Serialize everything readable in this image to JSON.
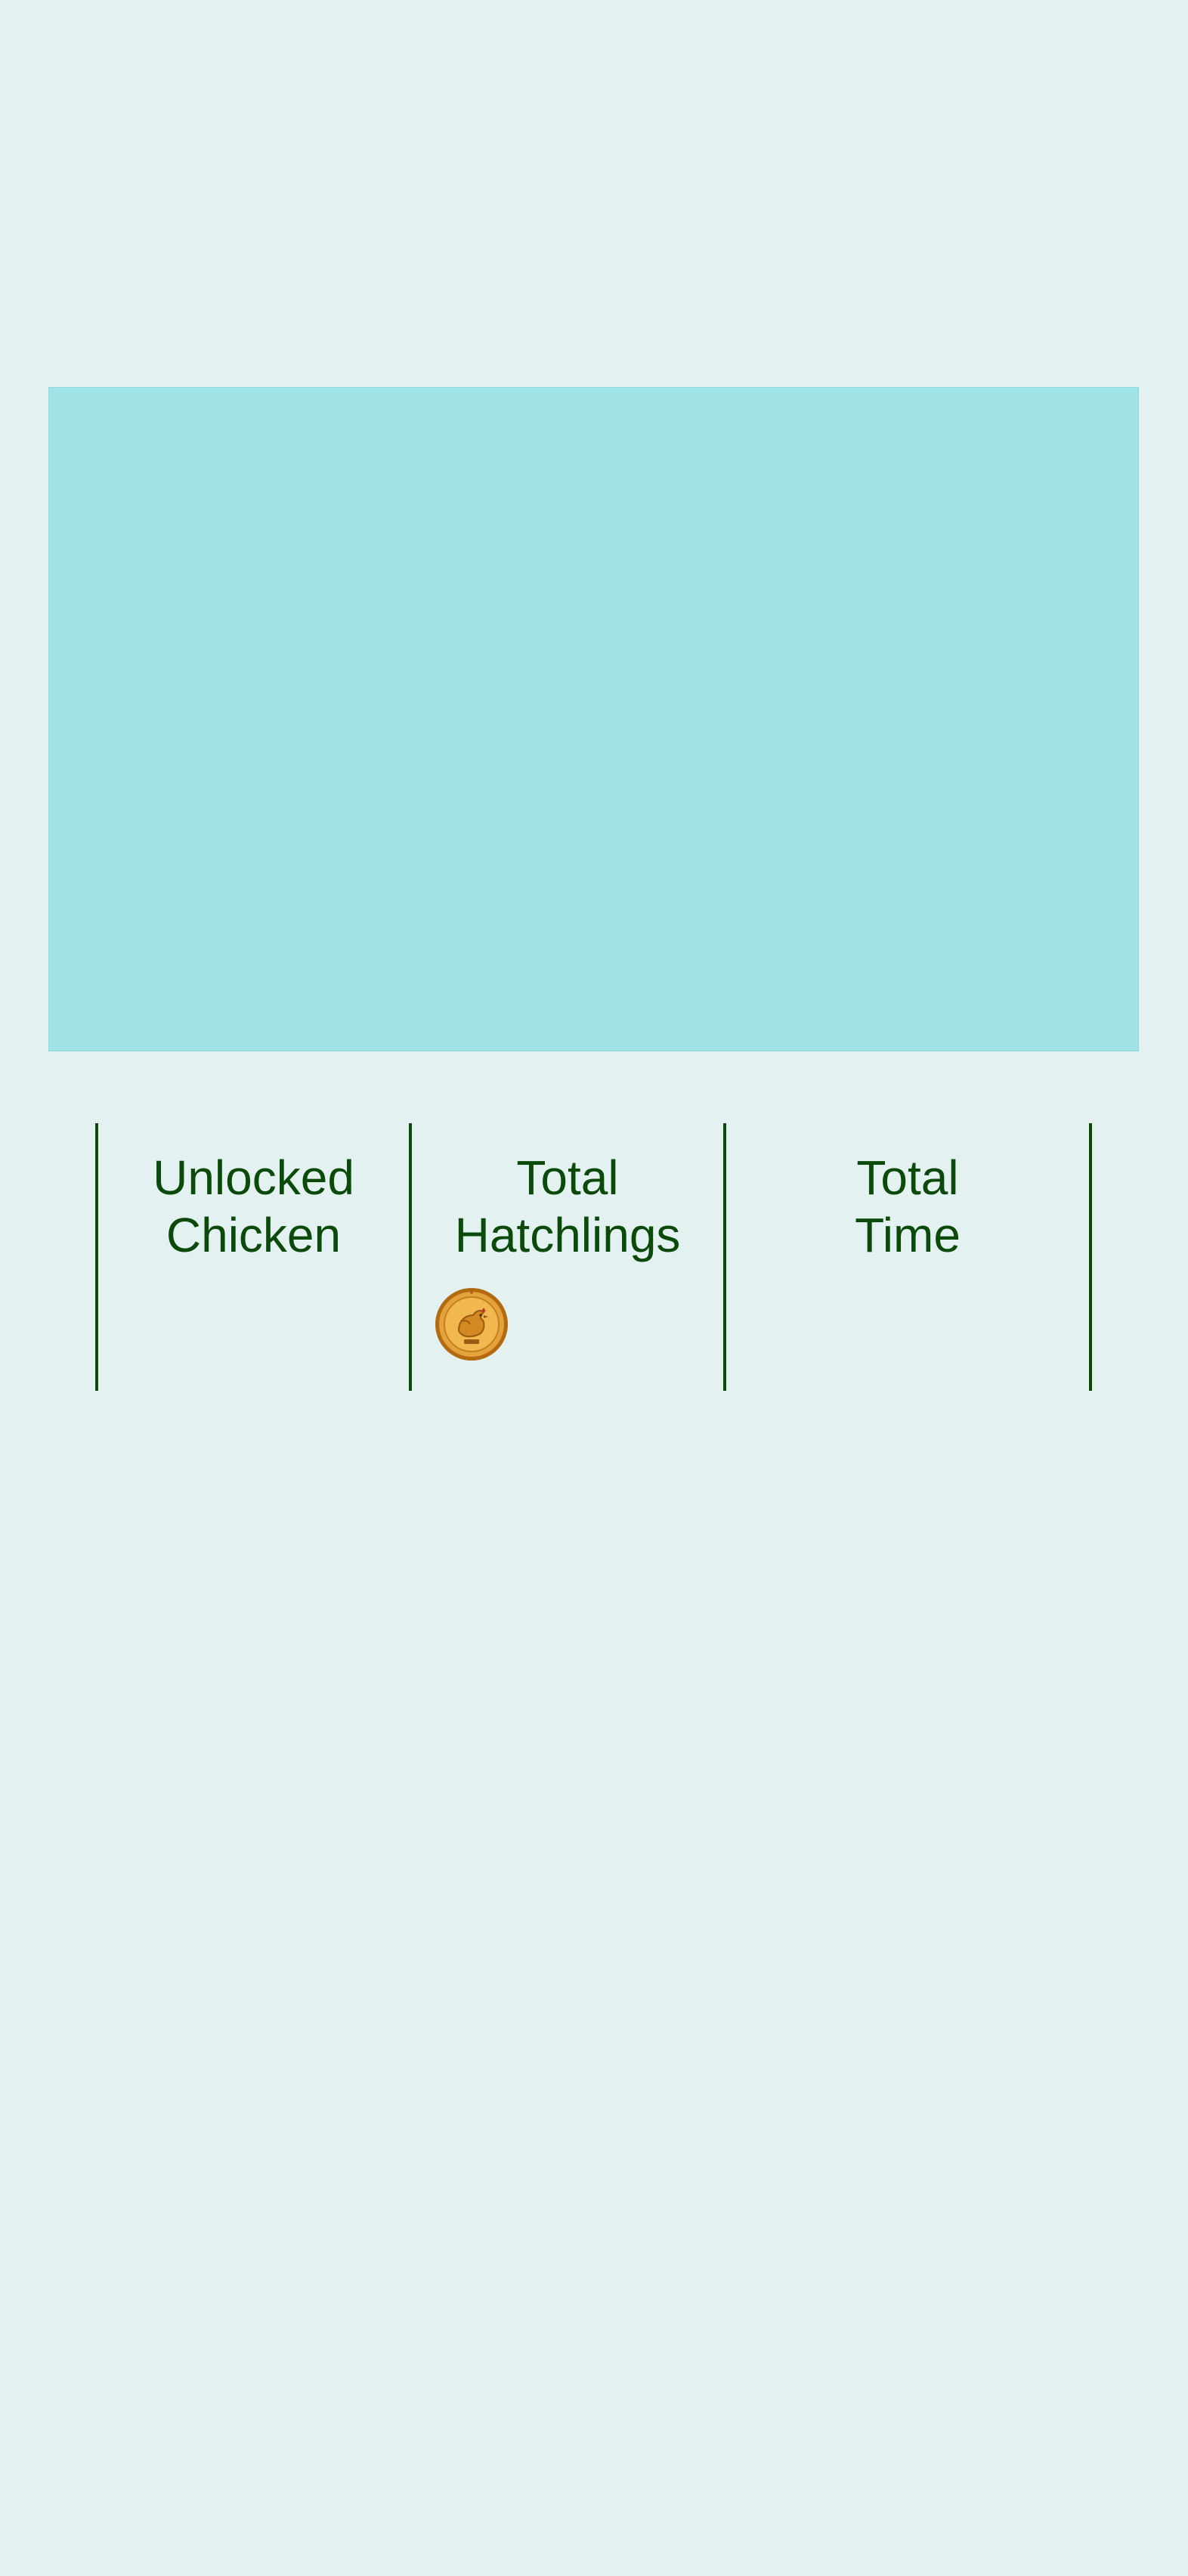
{
  "stats": {
    "unlocked_chicken": {
      "label": "Unlocked\nChicken"
    },
    "total_hatchlings": {
      "label": "Total\nHatchlings"
    },
    "total_time": {
      "label": "Total\nTime"
    }
  },
  "icons": {
    "coin": "chicken-coin-icon"
  },
  "colors": {
    "background": "#e3f1f1",
    "hero_panel": "#a0e3e7",
    "text_and_dividers": "#0b4a0b",
    "coin_gold": "#e0a23a"
  }
}
